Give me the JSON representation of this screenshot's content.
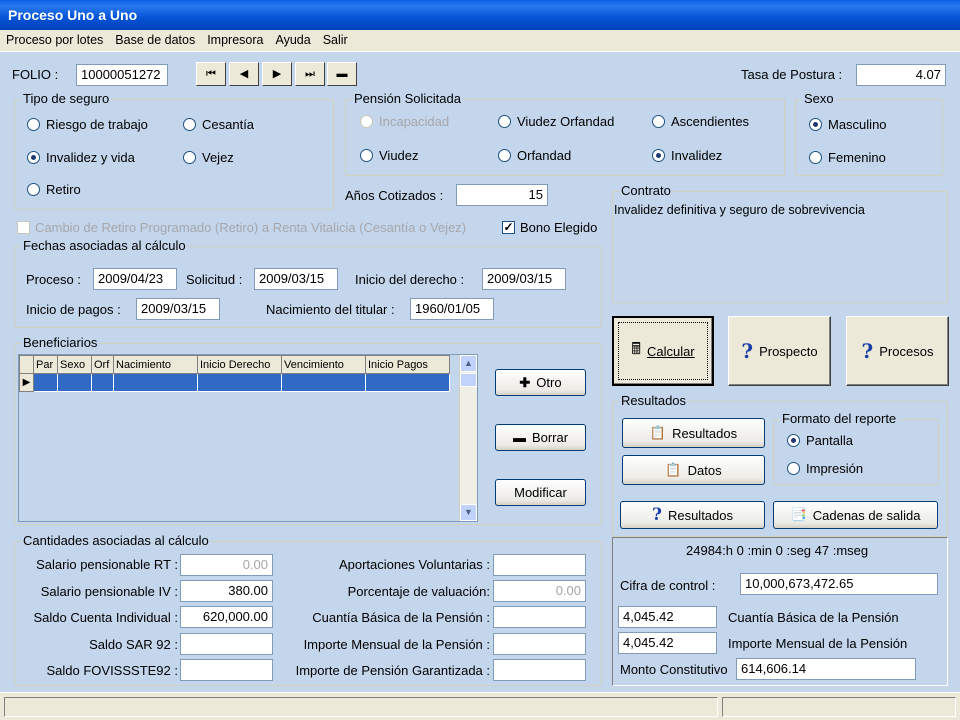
{
  "window": {
    "title": "Proceso Uno a Uno"
  },
  "menu": [
    "Proceso por lotes",
    "Base de datos",
    "Impresora",
    "Ayuda",
    "Salir"
  ],
  "folio": {
    "label": "FOLIO :",
    "value": "10000051272"
  },
  "tasa": {
    "label": "Tasa de Postura :",
    "value": "4.07"
  },
  "tipo_seguro": {
    "title": "Tipo de seguro",
    "options": [
      "Riesgo de trabajo",
      "Cesantía",
      "Invalidez y vida",
      "Vejez",
      "Retiro"
    ],
    "selected": "Invalidez y vida"
  },
  "pension": {
    "title": "Pensión Solicitada",
    "options": [
      "Incapacidad",
      "Viudez Orfandad",
      "Ascendientes",
      "Viudez",
      "Orfandad",
      "Invalidez"
    ],
    "selected": "Invalidez"
  },
  "sexo": {
    "title": "Sexo",
    "options": [
      "Masculino",
      "Femenino"
    ],
    "selected": "Masculino"
  },
  "anios": {
    "label": "Años Cotizados :",
    "value": "15"
  },
  "contrato": {
    "title": "Contrato",
    "text": "Invalidez definitiva y seguro de sobrevivencia"
  },
  "cambio_retiro": "Cambio de Retiro Programado (Retiro) a Renta Vitalicia (Cesantía o Vejez)",
  "bono": {
    "label": "Bono Elegido",
    "checked": true
  },
  "fechas": {
    "title": "Fechas asociadas al cálculo",
    "proceso_label": "Proceso :",
    "proceso": "2009/04/23",
    "solicitud_label": "Solicitud :",
    "solicitud": "2009/03/15",
    "inicio_derecho_label": "Inicio del derecho :",
    "inicio_derecho": "2009/03/15",
    "inicio_pagos_label": "Inicio de pagos :",
    "inicio_pagos": "2009/03/15",
    "nacimiento_label": "Nacimiento del titular :",
    "nacimiento": "1960/01/05"
  },
  "buttons": {
    "calcular": "Calcular",
    "prospecto": "Prospecto",
    "procesos": "Procesos",
    "otro": "Otro",
    "borrar": "Borrar",
    "modificar": "Modificar",
    "resultados": "Resultados",
    "datos": "Datos",
    "resultados2": "Resultados",
    "cadenas": "Cadenas de salida"
  },
  "beneficiarios": {
    "title": "Beneficiarios",
    "columns": [
      "Par",
      "Sexo",
      "Orf",
      "Nacimiento",
      "Inicio Derecho",
      "Vencimiento",
      "Inicio Pagos"
    ]
  },
  "resultados": {
    "title": "Resultados",
    "formato_title": "Formato del reporte",
    "formato_options": [
      "Pantalla",
      "Impresión"
    ],
    "formato_selected": "Pantalla",
    "tiempo": "24984:h 0 :min 0 :seg 47 :mseg",
    "cifra_label": "Cifra de control :",
    "cifra": "10,000,673,472.65",
    "cuantia_value": "4,045.42",
    "cuantia_label": "Cuantía Básica de la Pensión",
    "importe_value": "4,045.42",
    "importe_label": "Importe Mensual de la Pensión",
    "monto_label": "Monto Constitutivo",
    "monto": "614,606.14"
  },
  "cantidades": {
    "title": "Cantidades asociadas al cálculo",
    "left": [
      {
        "label": "Salario pensionable RT :",
        "value": "0.00",
        "disabled": true
      },
      {
        "label": "Salario pensionable IV :",
        "value": "380.00",
        "disabled": false
      },
      {
        "label": "Saldo Cuenta Individual :",
        "value": "620,000.00",
        "disabled": false
      },
      {
        "label": "Saldo SAR 92 :",
        "value": "",
        "disabled": false
      },
      {
        "label": "Saldo FOVISSSTE92 :",
        "value": "",
        "disabled": false
      }
    ],
    "right": [
      {
        "label": "Aportaciones Voluntarias :",
        "value": "",
        "disabled": false
      },
      {
        "label": "Porcentaje de valuación:",
        "value": "0.00",
        "disabled": true
      },
      {
        "label": "Cuantía Básica de la Pensión :",
        "value": "",
        "disabled": false
      },
      {
        "label": "Importe Mensual de la Pensión :",
        "value": "",
        "disabled": false
      },
      {
        "label": "Importe de Pensión Garantizada :",
        "value": "",
        "disabled": false
      }
    ]
  },
  "colors": {
    "title_bar": "#0553D6",
    "client_bg": "#C4D6EC",
    "selected_row": "#316AC5",
    "question": "#1A3FA8"
  }
}
